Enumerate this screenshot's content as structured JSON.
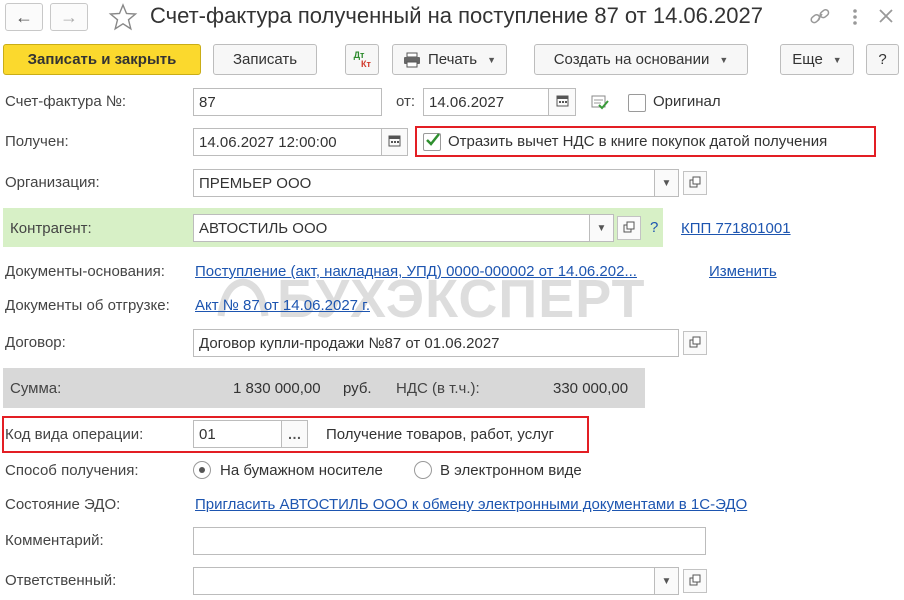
{
  "window": {
    "title": "Счет-фактура полученный на поступление 87 от 14.06.2027"
  },
  "toolbar": {
    "save_close": "Записать и закрыть",
    "save": "Записать",
    "dtkt_dt": "Дт",
    "dtkt_kt": "Кт",
    "print": "Печать",
    "create_based": "Создать на основании",
    "more": "Еще",
    "help": "?"
  },
  "form": {
    "invoice_label": "Счет-фактура №:",
    "invoice_number": "87",
    "from_label": "от:",
    "invoice_date": "14.06.2027",
    "original_label": "Оригинал",
    "received_label": "Получен:",
    "received_datetime": "14.06.2027 12:00:00",
    "vat_deduction_label": "Отразить вычет НДС в книге покупок датой получения",
    "org_label": "Организация:",
    "org_value": "ПРЕМЬЕР ООО",
    "counterparty_label": "Контрагент:",
    "counterparty_value": "АВТОСТИЛЬ ООО",
    "kpp_link": "КПП 771801001",
    "base_docs_label": "Документы-основания:",
    "base_docs_link": "Поступление (акт, накладная, УПД) 0000-000002 от 14.06.202...",
    "change_link": "Изменить",
    "shipping_docs_label": "Документы об отгрузке:",
    "shipping_docs_link": "Акт № 87 от 14.06.2027 г.",
    "contract_label": "Договор:",
    "contract_value": "Договор купли-продажи №87 от 01.06.2027",
    "sum_label": "Сумма:",
    "sum_value": "1 830 000,00",
    "currency": "руб.",
    "vat_label": "НДС (в т.ч.):",
    "vat_value": "330 000,00",
    "op_code_label": "Код вида операции:",
    "op_code_value": "01",
    "op_code_desc": "Получение товаров, работ, услуг",
    "receipt_method_label": "Способ получения:",
    "receipt_paper": "На бумажном носителе",
    "receipt_electronic": "В электронном виде",
    "edo_label": "Состояние ЭДО:",
    "edo_link": "Пригласить АВТОСТИЛЬ ООО к обмену электронными документами в 1С-ЭДО",
    "comment_label": "Комментарий:",
    "comment_value": "",
    "responsible_label": "Ответственный:",
    "responsible_value": ""
  },
  "watermark": "БУХЭКСПЕРТ",
  "colors": {
    "primary_button": "#fbd92d",
    "highlight_red": "#e31e24",
    "link_blue": "#1d55b0",
    "counterparty_bg": "#d7f0c6",
    "sum_bg": "#d8d8d8"
  }
}
